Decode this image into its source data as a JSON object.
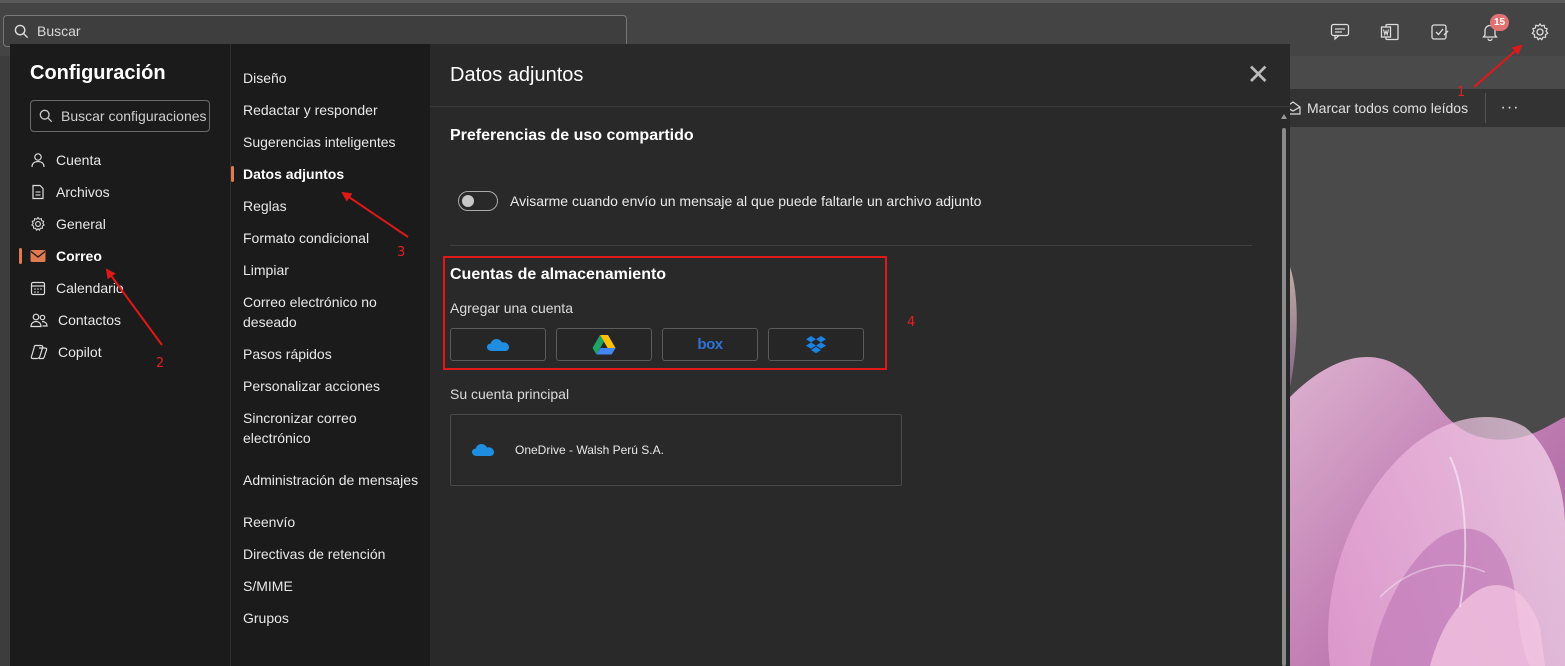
{
  "topbar": {
    "search_placeholder": "Buscar",
    "icons": [
      "chat-icon",
      "office-word-icon",
      "note-icon",
      "bell-icon",
      "gear-icon"
    ],
    "notification_count": "15"
  },
  "background": {
    "mark_all_read": "Marcar todos como leídos",
    "more": "···"
  },
  "settings": {
    "title": "Configuración",
    "search_placeholder": "Buscar configuraciones",
    "categories": [
      {
        "label": "Cuenta",
        "icon": "person-icon"
      },
      {
        "label": "Archivos",
        "icon": "file-icon"
      },
      {
        "label": "General",
        "icon": "gear-icon"
      },
      {
        "label": "Correo",
        "icon": "mail-icon",
        "active": true
      },
      {
        "label": "Calendario",
        "icon": "calendar-icon"
      },
      {
        "label": "Contactos",
        "icon": "people-icon"
      },
      {
        "label": "Copilot",
        "icon": "copilot-icon"
      }
    ],
    "mail_sections": [
      "Diseño",
      "Redactar y responder",
      "Sugerencias inteligentes",
      "Datos adjuntos",
      "Reglas",
      "Formato condicional",
      "Limpiar",
      "Correo electrónico no deseado",
      "Pasos rápidos",
      "Personalizar acciones",
      "Sincronizar correo electrónico",
      "Administración de mensajes",
      "Reenvío",
      "Directivas de retención",
      "S/MIME",
      "Grupos"
    ],
    "active_section": "Datos adjuntos"
  },
  "panel": {
    "title": "Datos adjuntos",
    "share_heading": "Preferencias de uso compartido",
    "toggle_label": "Avisarme cuando envío un mensaje al que puede faltarle un archivo adjunto",
    "toggle_on": false,
    "storage_heading": "Cuentas de almacenamiento",
    "add_account": "Agregar una cuenta",
    "providers": [
      "onedrive-icon",
      "google-drive-icon",
      "box-icon",
      "dropbox-icon"
    ],
    "box_text": "box",
    "main_account_label": "Su cuenta principal",
    "main_account_name": "OneDrive - Walsh Perú S.A."
  },
  "annotations": {
    "labels": [
      "1",
      "2",
      "3",
      "4"
    ],
    "color": "#e01818"
  },
  "colors": {
    "accent": "#e07a50",
    "badge": "#e07272",
    "onedrive": "#1f8ee0",
    "box": "#2f71d6",
    "dropbox": "#1a82e2"
  }
}
